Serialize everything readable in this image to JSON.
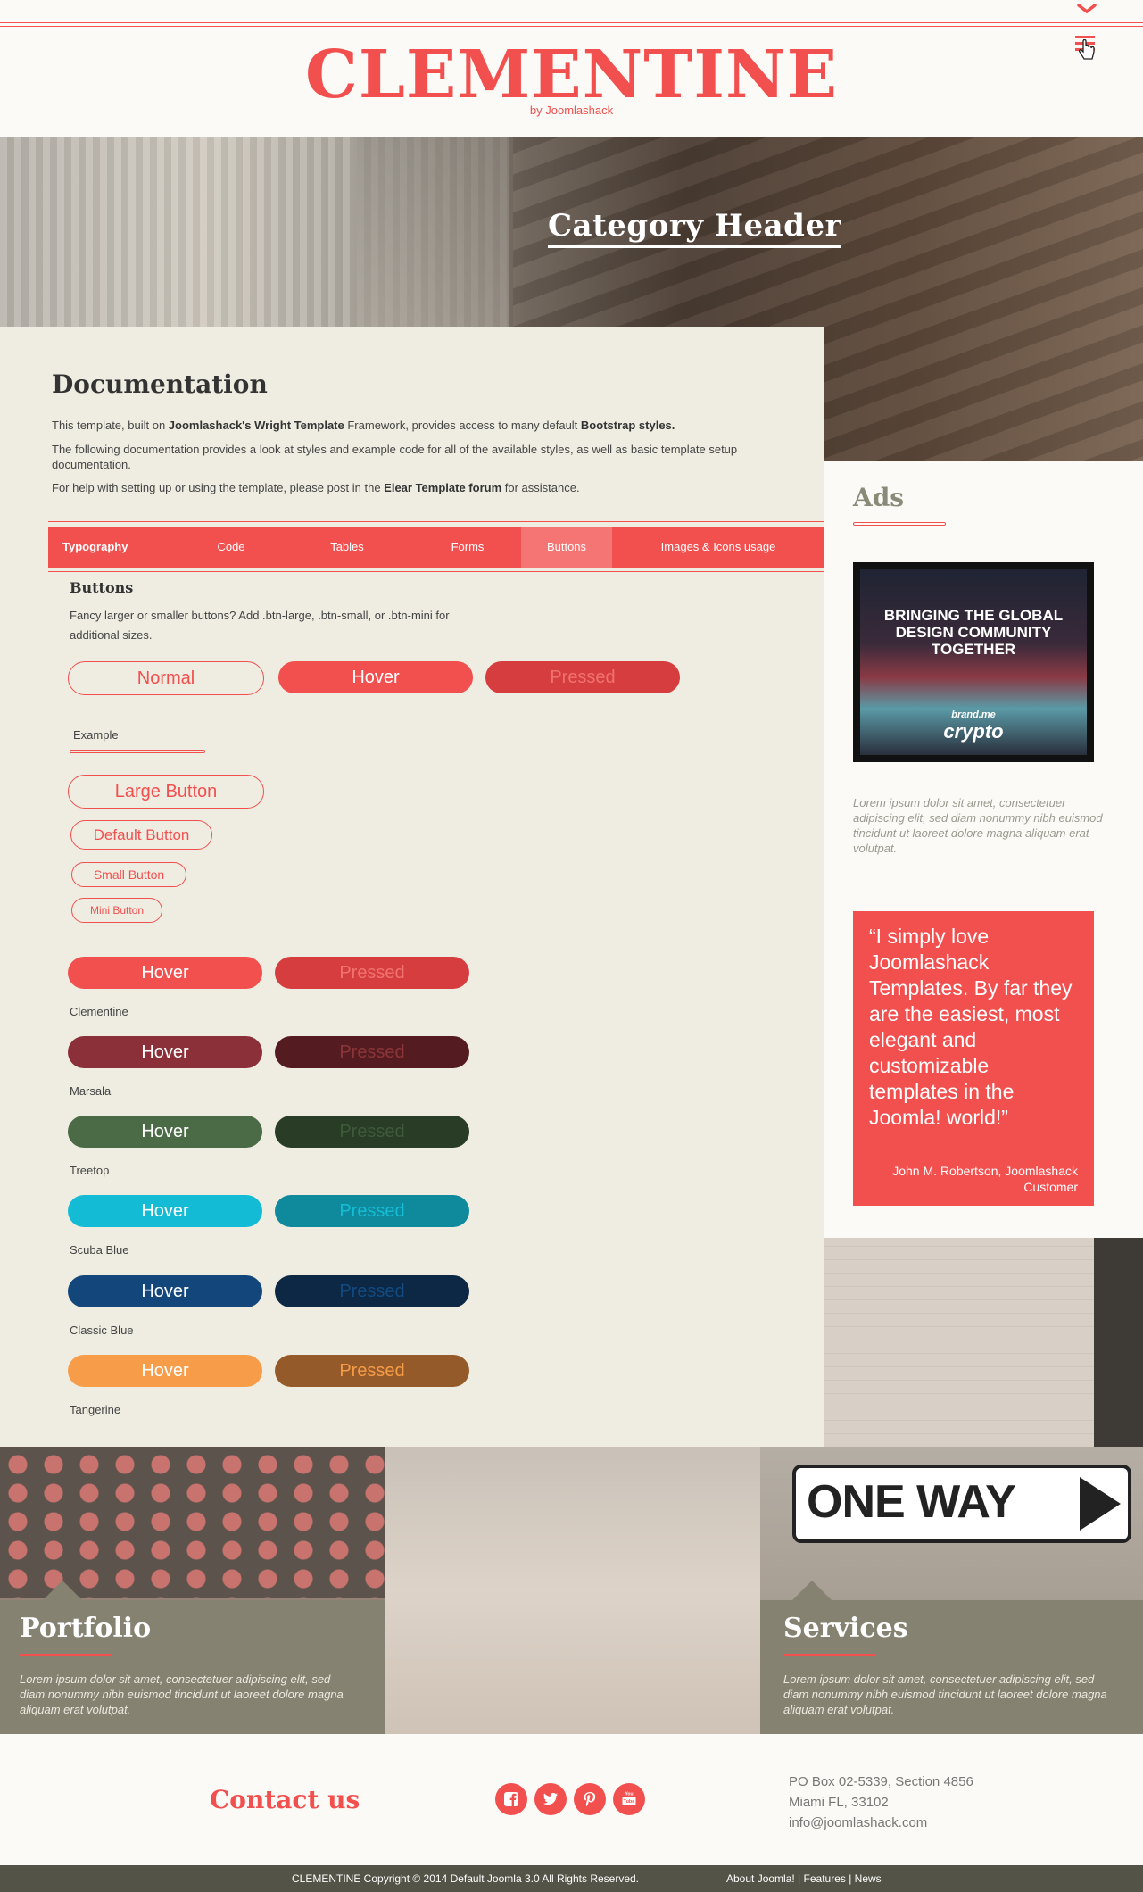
{
  "header": {
    "brand": "CLEMENTINE",
    "byline": "by Joomlashack"
  },
  "hero": {
    "title": "Category Header"
  },
  "doc": {
    "title": "Documentation",
    "p1_a": "This template, built on ",
    "p1_b": "Joomlashack's Wright Template",
    "p1_c": " Framework, provides access to many default ",
    "p1_d": "Bootstrap styles.",
    "p2": "The following documentation provides a look at styles and example code for all of the available styles, as well as basic template setup documentation.",
    "p3_a": "For help with setting up or using the template, please post in the ",
    "p3_b": "Elear Template forum",
    "p3_c": " for assistance."
  },
  "tabs": [
    "Typography",
    "Code",
    "Tables",
    "Forms",
    "Buttons",
    "Images & Icons usage"
  ],
  "active_tab": "Buttons",
  "buttons_section": {
    "title": "Buttons",
    "desc_1": "Fancy larger or smaller buttons? Add .btn-large, .btn-small, or .btn-mini for",
    "desc_2": "additional sizes.",
    "state_normal": "Normal",
    "state_hover": "Hover",
    "state_pressed": "Pressed",
    "example_label": "Example",
    "large": "Large Button",
    "default": "Default Button",
    "small": "Small Button",
    "mini": "Mini Button",
    "swatches": [
      {
        "name": "Clementine",
        "hover": "Hover",
        "pressed": "Pressed",
        "color": "#f24f4f",
        "pressed_color": "#d63d3f",
        "pressed_text": "#f0726f"
      },
      {
        "name": "Marsala",
        "hover": "Hover",
        "pressed": "Pressed",
        "color": "#8b3038",
        "pressed_color": "#541c20",
        "pressed_text": "#8a3539"
      },
      {
        "name": "Treetop",
        "hover": "Hover",
        "pressed": "Pressed",
        "color": "#4a6b45",
        "pressed_color": "#283c26",
        "pressed_text": "#3e5a3a"
      },
      {
        "name": "Scuba Blue",
        "hover": "Hover",
        "pressed": "Pressed",
        "color": "#13bbd4",
        "pressed_color": "#0f8a9c",
        "pressed_text": "#14bdd6"
      },
      {
        "name": "Classic Blue",
        "hover": "Hover",
        "pressed": "Pressed",
        "color": "#13477c",
        "pressed_color": "#0c2844",
        "pressed_text": "#134a80"
      },
      {
        "name": "Tangerine",
        "hover": "Hover",
        "pressed": "Pressed",
        "color": "#f79c48",
        "pressed_color": "#955a2a",
        "pressed_text": "#f49b48"
      }
    ]
  },
  "sidebar": {
    "ads_title": "Ads",
    "ad_text": "BRINGING THE GLOBAL DESIGN COMMUNITY TOGETHER",
    "ad_brand": "crypto",
    "ad_brand_small": "brand.me",
    "lorem": "Lorem ipsum dolor sit amet, consectetuer adipiscing elit, sed diam nonummy nibh euismod tincidunt ut laoreet dolore magna aliquam erat volutpat.",
    "quote": "“I simply love Joomlashack Templates. By far they are the easiest, most elegant and customizable templates in the Joomla! world!”",
    "quote_author": "John M. Robertson, Joomlashack Customer"
  },
  "tiles": {
    "sign_text": "ONE WAY",
    "portfolio_title": "Portfolio",
    "portfolio_text": "Lorem ipsum dolor sit amet, consectetuer adipiscing elit, sed diam nonummy nibh euismod tincidunt ut laoreet dolore magna aliquam erat volutpat.",
    "services_title": "Services",
    "services_text": "Lorem ipsum dolor sit amet, consectetuer adipiscing elit, sed diam nonummy nibh euismod tincidunt ut laoreet dolore magna aliquam erat volutpat."
  },
  "contact": {
    "title": "Contact us",
    "social_icons": [
      "facebook-icon",
      "twitter-icon",
      "pinterest-icon",
      "youtube-icon"
    ],
    "address_1": "PO Box 02-5339, Section 4856",
    "address_2": "Miami FL, 33102",
    "email": "info@joomlashack.com"
  },
  "footer": {
    "copyright": "CLEMENTINE Copyright © 2014 Default Joomla 3.0 All Rights Reserved.",
    "link_about": "About Joomla!",
    "link_features": "Features",
    "link_news": "News",
    "sep": " | "
  },
  "colors": {
    "accent": "#f24f4f",
    "panel": "#858272",
    "content_bg": "#efede1",
    "footer": "#535447"
  }
}
